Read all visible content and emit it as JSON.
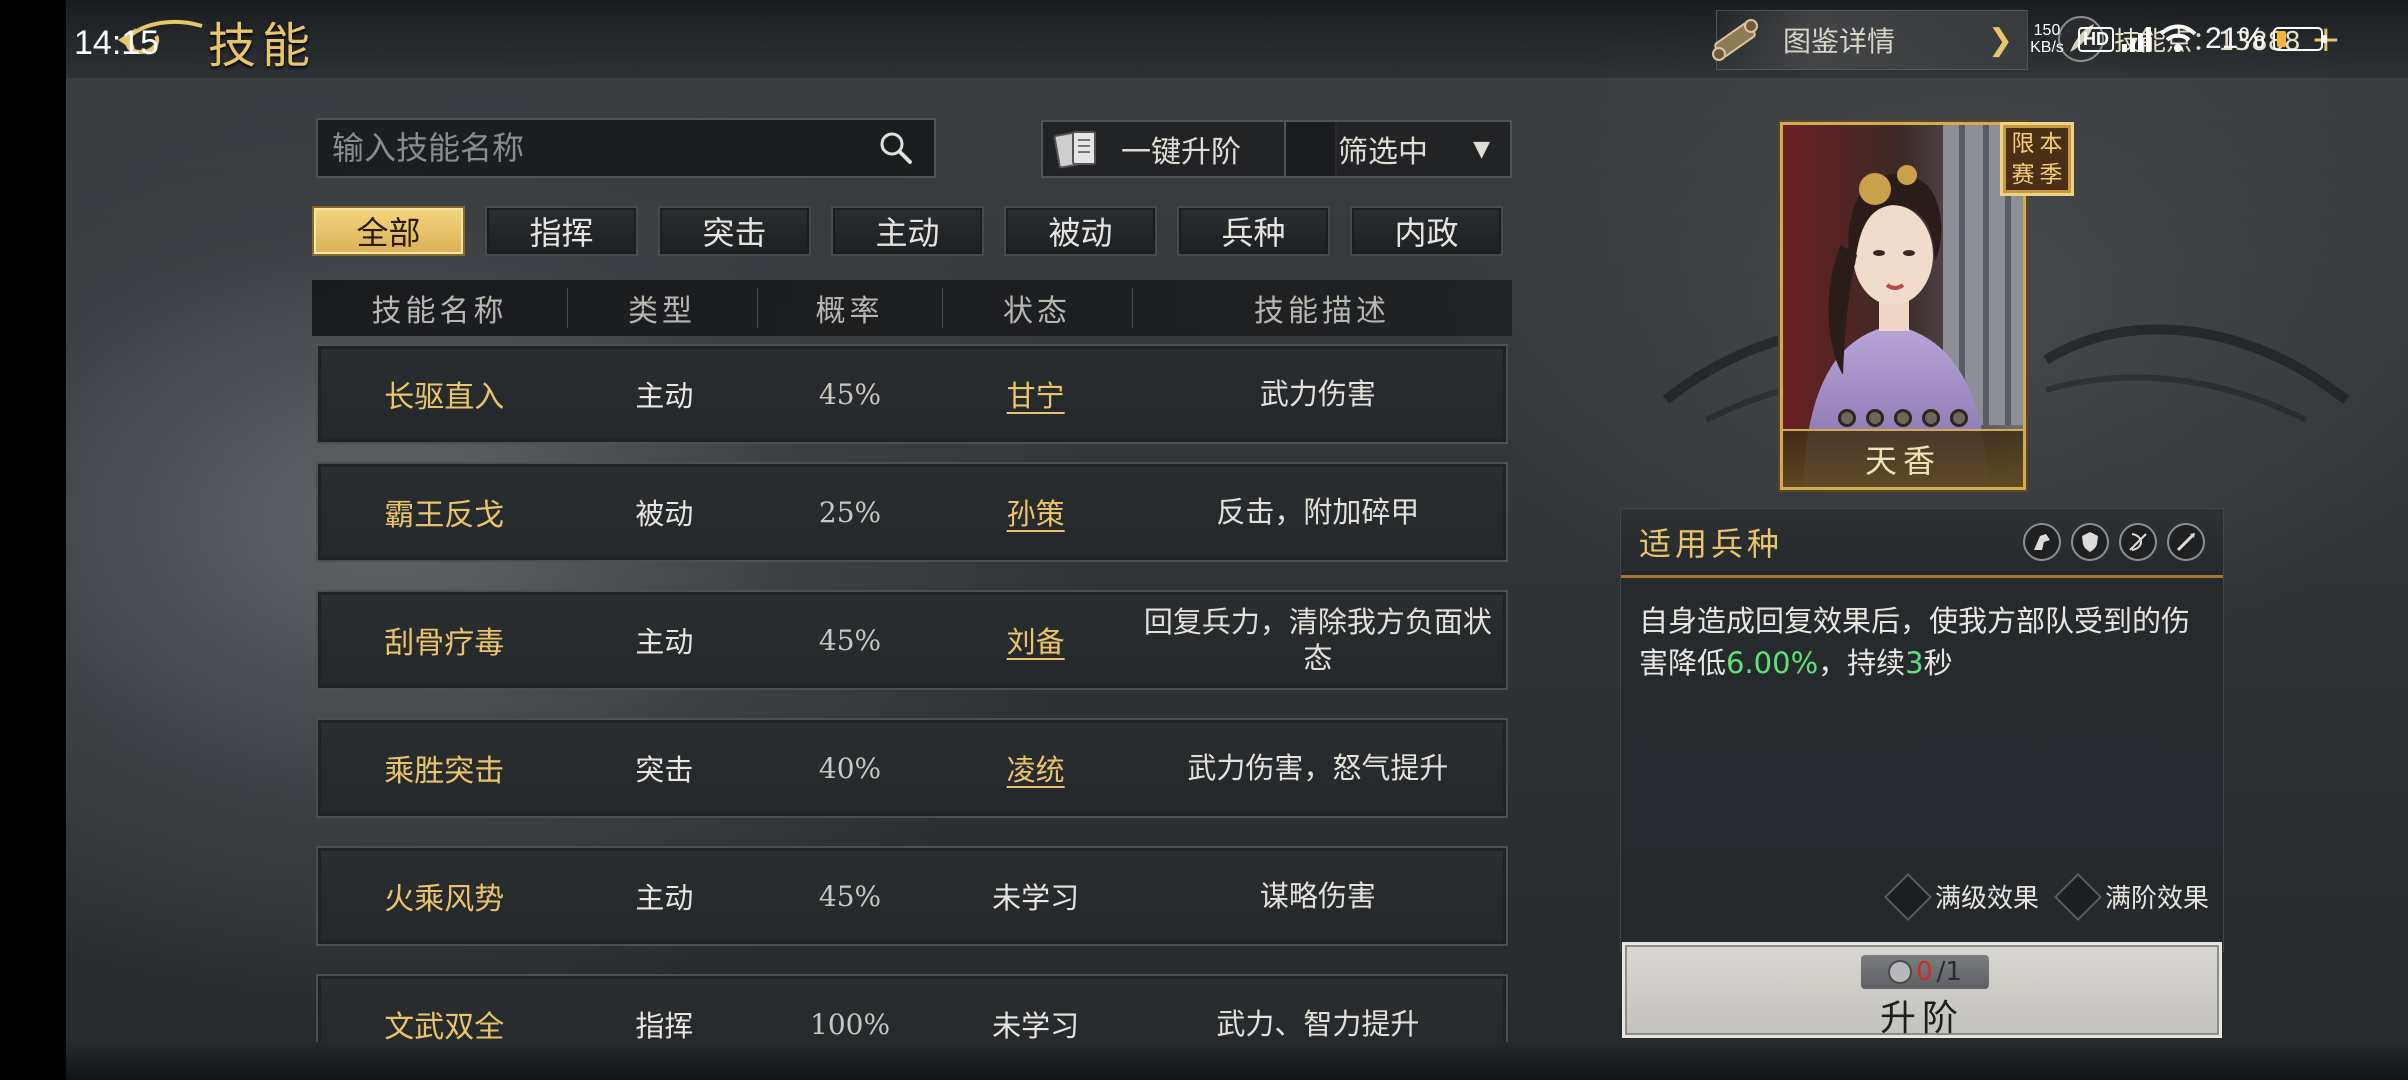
{
  "status_bar": {
    "time": "14:15",
    "net_speed_value": "150",
    "net_speed_unit": "KB/s",
    "hd": "HD",
    "battery_pct": "21%",
    "battery_level": 0.21,
    "icons": [
      "signal-icon",
      "wifi-icon",
      "battery-icon"
    ]
  },
  "header": {
    "title": "技能",
    "codex_label": "图鉴详情",
    "skill_points_text": "技能点：13888"
  },
  "search": {
    "placeholder": "输入技能名称"
  },
  "actions": {
    "upgrade_all": "一键升阶",
    "filter": "筛选中"
  },
  "tabs": [
    {
      "label": "全部",
      "active": true
    },
    {
      "label": "指挥",
      "active": false
    },
    {
      "label": "突击",
      "active": false
    },
    {
      "label": "主动",
      "active": false
    },
    {
      "label": "被动",
      "active": false
    },
    {
      "label": "兵种",
      "active": false
    },
    {
      "label": "内政",
      "active": false
    }
  ],
  "table": {
    "headers": [
      "技能名称",
      "类型",
      "概率",
      "状态",
      "技能描述"
    ],
    "rows": [
      {
        "name": "长驱直入",
        "type": "主动",
        "rate": "45%",
        "status": "甘宁",
        "status_is_link": true,
        "desc": "武力伤害"
      },
      {
        "name": "霸王反戈",
        "type": "被动",
        "rate": "25%",
        "status": "孙策",
        "status_is_link": true,
        "desc": "反击，附加碎甲"
      },
      {
        "name": "刮骨疗毒",
        "type": "主动",
        "rate": "45%",
        "status": "刘备",
        "status_is_link": true,
        "desc": "回复兵力，清除我方负面状态"
      },
      {
        "name": "乘胜突击",
        "type": "突击",
        "rate": "40%",
        "status": "凌统",
        "status_is_link": true,
        "desc": "武力伤害，怒气提升"
      },
      {
        "name": "火乘风势",
        "type": "主动",
        "rate": "45%",
        "status": "未学习",
        "status_is_link": false,
        "desc": "谋略伤害"
      },
      {
        "name": "文武双全",
        "type": "指挥",
        "rate": "100%",
        "status": "未学习",
        "status_is_link": false,
        "desc": "武力、智力提升"
      }
    ]
  },
  "hero": {
    "name": "天香",
    "season_badge": [
      "本",
      "限",
      "季",
      "赛"
    ],
    "stars_total": 5
  },
  "troop_panel": {
    "title": "适用兵种",
    "troop_icons": [
      "cavalry-icon",
      "shield-icon",
      "bow-icon",
      "spear-icon"
    ],
    "desc_prefix": "自身造成回复效果后，使我方部队受到的伤害降低",
    "desc_value": "6.00%",
    "desc_mid": "，持续",
    "desc_turns": "3",
    "desc_suffix": "秒",
    "toggle_max_level": "满级效果",
    "toggle_max_rank": "满阶效果"
  },
  "ascend": {
    "have": "0",
    "sep_need": "/1",
    "label": "升阶"
  },
  "colors": {
    "accent_gold": "#e8c46a",
    "highlight_green": "#5fe07a",
    "cost_red": "#d02a26"
  }
}
